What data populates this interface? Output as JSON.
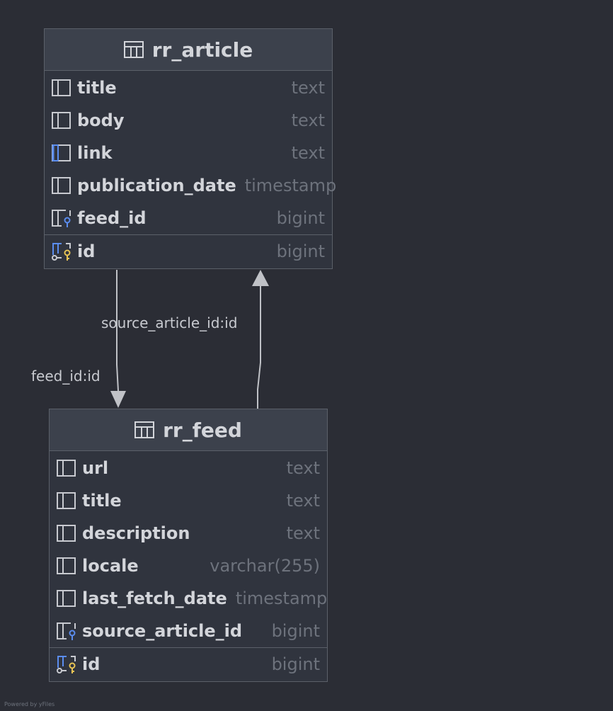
{
  "tables": [
    {
      "name": "rr_article",
      "columns": [
        {
          "name": "title",
          "type": "text",
          "icon": "column-icon"
        },
        {
          "name": "body",
          "type": "text",
          "icon": "column-icon"
        },
        {
          "name": "link",
          "type": "text",
          "icon": "column-unique-icon"
        },
        {
          "name": "publication_date",
          "type": "timestamp",
          "icon": "column-icon"
        },
        {
          "name": "feed_id",
          "type": "bigint",
          "icon": "foreign-key-icon"
        }
      ],
      "primary_key": {
        "name": "id",
        "type": "bigint",
        "icon": "primary-key-icon"
      }
    },
    {
      "name": "rr_feed",
      "columns": [
        {
          "name": "url",
          "type": "text",
          "icon": "column-icon"
        },
        {
          "name": "title",
          "type": "text",
          "icon": "column-icon"
        },
        {
          "name": "description",
          "type": "text",
          "icon": "column-icon"
        },
        {
          "name": "locale",
          "type": "varchar(255)",
          "icon": "column-icon"
        },
        {
          "name": "last_fetch_date",
          "type": "timestamp",
          "icon": "column-icon"
        },
        {
          "name": "source_article_id",
          "type": "bigint",
          "icon": "foreign-key-icon"
        }
      ],
      "primary_key": {
        "name": "id",
        "type": "bigint",
        "icon": "primary-key-icon"
      }
    }
  ],
  "relations": [
    {
      "label": "feed_id:id",
      "from": "rr_article",
      "to": "rr_feed"
    },
    {
      "label": "source_article_id:id",
      "from": "rr_feed",
      "to": "rr_article"
    }
  ],
  "footer": "Powered by yFiles",
  "colors": {
    "background": "#2b2d35",
    "table_body": "#30343e",
    "table_header": "#3c414c",
    "border": "#5b6069",
    "text": "#d3d5da",
    "type_text": "#6d727c",
    "edge": "#c0c2c7",
    "fk_accent": "#5b8def",
    "pk_key": "#e8c454"
  }
}
